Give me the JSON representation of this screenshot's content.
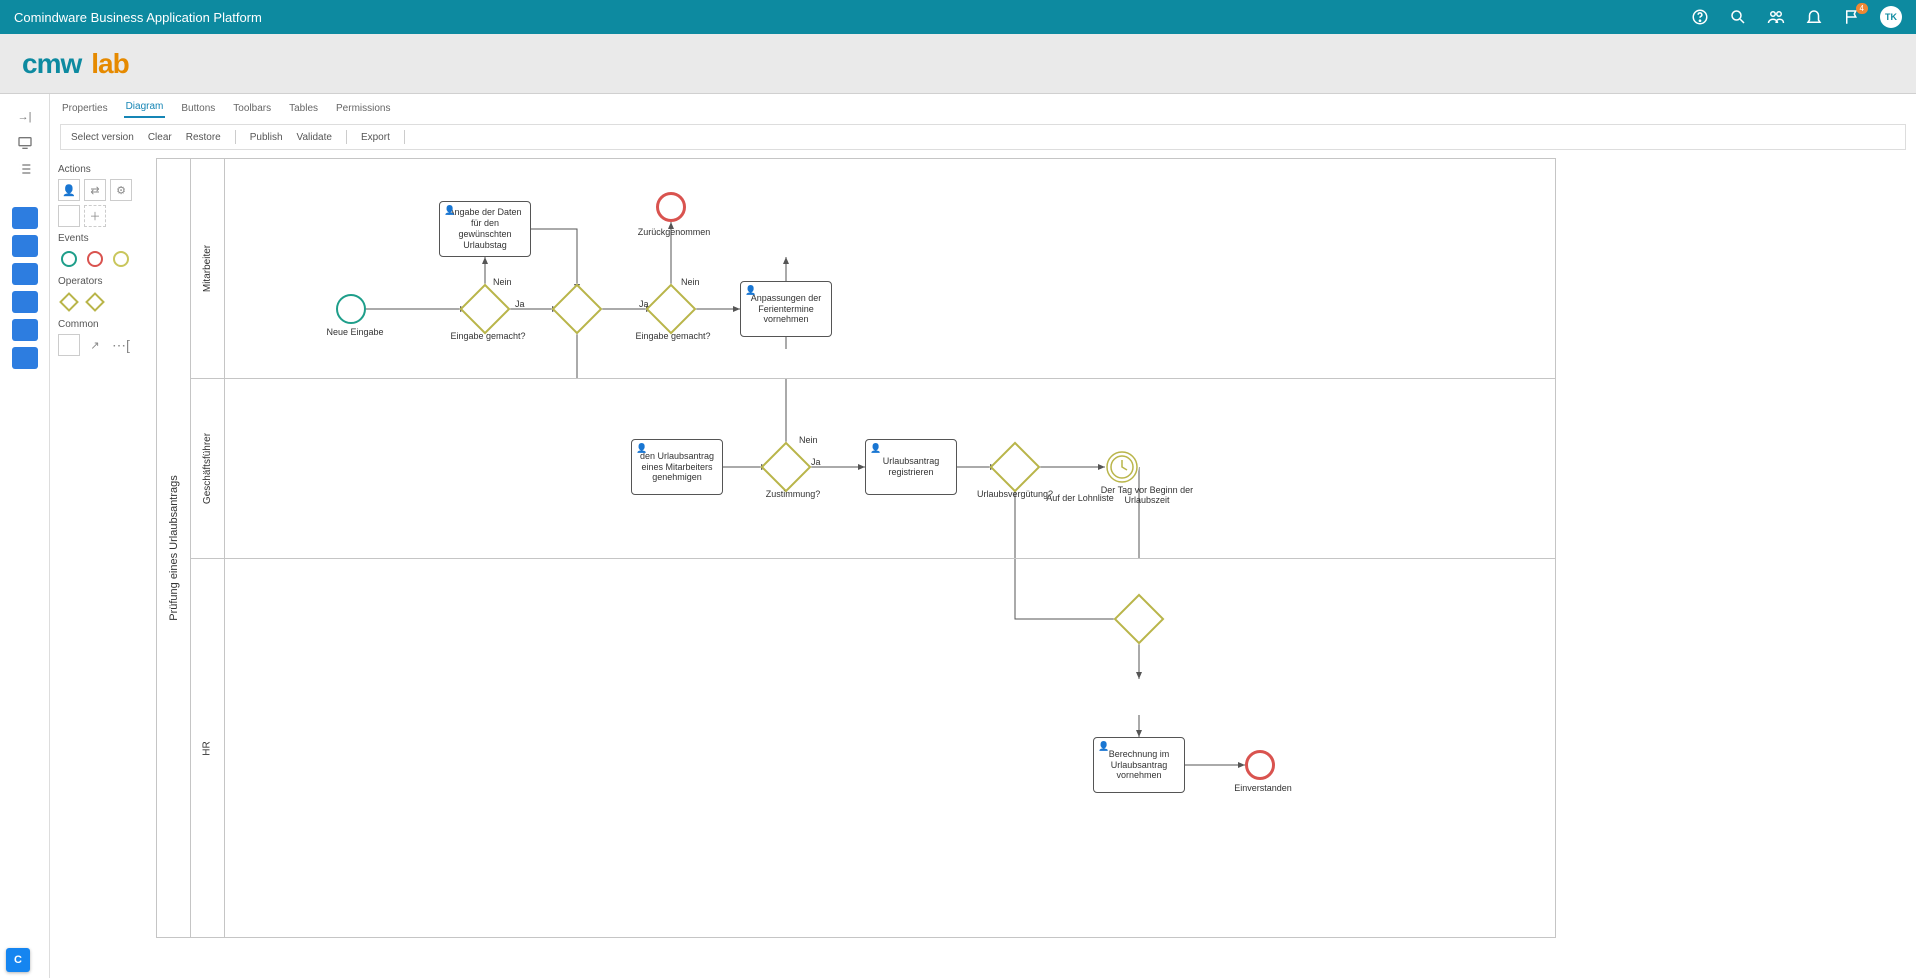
{
  "header": {
    "title": "Comindware Business Application Platform",
    "user_initials": "TK",
    "notif_count": "4"
  },
  "logo": {
    "part1": "cmw",
    "part2": "lab"
  },
  "tabs": [
    "Properties",
    "Diagram",
    "Buttons",
    "Toolbars",
    "Tables",
    "Permissions"
  ],
  "tabs_active": 1,
  "toolbar": [
    "Select version",
    "Clear",
    "Restore",
    "Publish",
    "Validate",
    "Export"
  ],
  "palette": {
    "g1": "Actions",
    "g2": "Events",
    "g3": "Operators",
    "g4": "Common"
  },
  "pool": "Prüfung eines Urlaubsantrags",
  "lanes": {
    "l1": "Mitarbeiter",
    "l2": "Geschäftsführer",
    "l3": "HR"
  },
  "nodes": {
    "start": {
      "label": "Neue Eingabe"
    },
    "task_angabe": {
      "label": "Angabe der Daten für den gewünschten Urlaubstag"
    },
    "gw1": {
      "label": "Eingabe gemacht?",
      "yes": "Ja",
      "no": "Nein"
    },
    "gw2": {
      "label": ""
    },
    "end_zurueck": {
      "label": "Zurückgenommen"
    },
    "gw3": {
      "label": "Eingabe gemacht?",
      "yes": "Ja",
      "no": "Nein"
    },
    "task_anpass": {
      "label": "Anpassungen der Ferientermine vornehmen"
    },
    "task_genehm": {
      "label": "den Urlaubsantrag eines Mitarbeiters genehmigen"
    },
    "gw_zust": {
      "label": "Zustimmung?",
      "yes": "Ja",
      "no": "Nein"
    },
    "task_reg": {
      "label": "Urlaubsantrag registrieren"
    },
    "gw_verguet": {
      "label": "Urlaubsvergütung?",
      "sub": "Auf der Lohnliste"
    },
    "timer": {
      "label": "Der Tag vor Beginn der Urlaubszeit"
    },
    "gw_merge": {
      "label": ""
    },
    "task_berech": {
      "label": "Berechnung im Urlaubsantrag vornehmen"
    },
    "end_ok": {
      "label": "Einverstanden"
    }
  }
}
